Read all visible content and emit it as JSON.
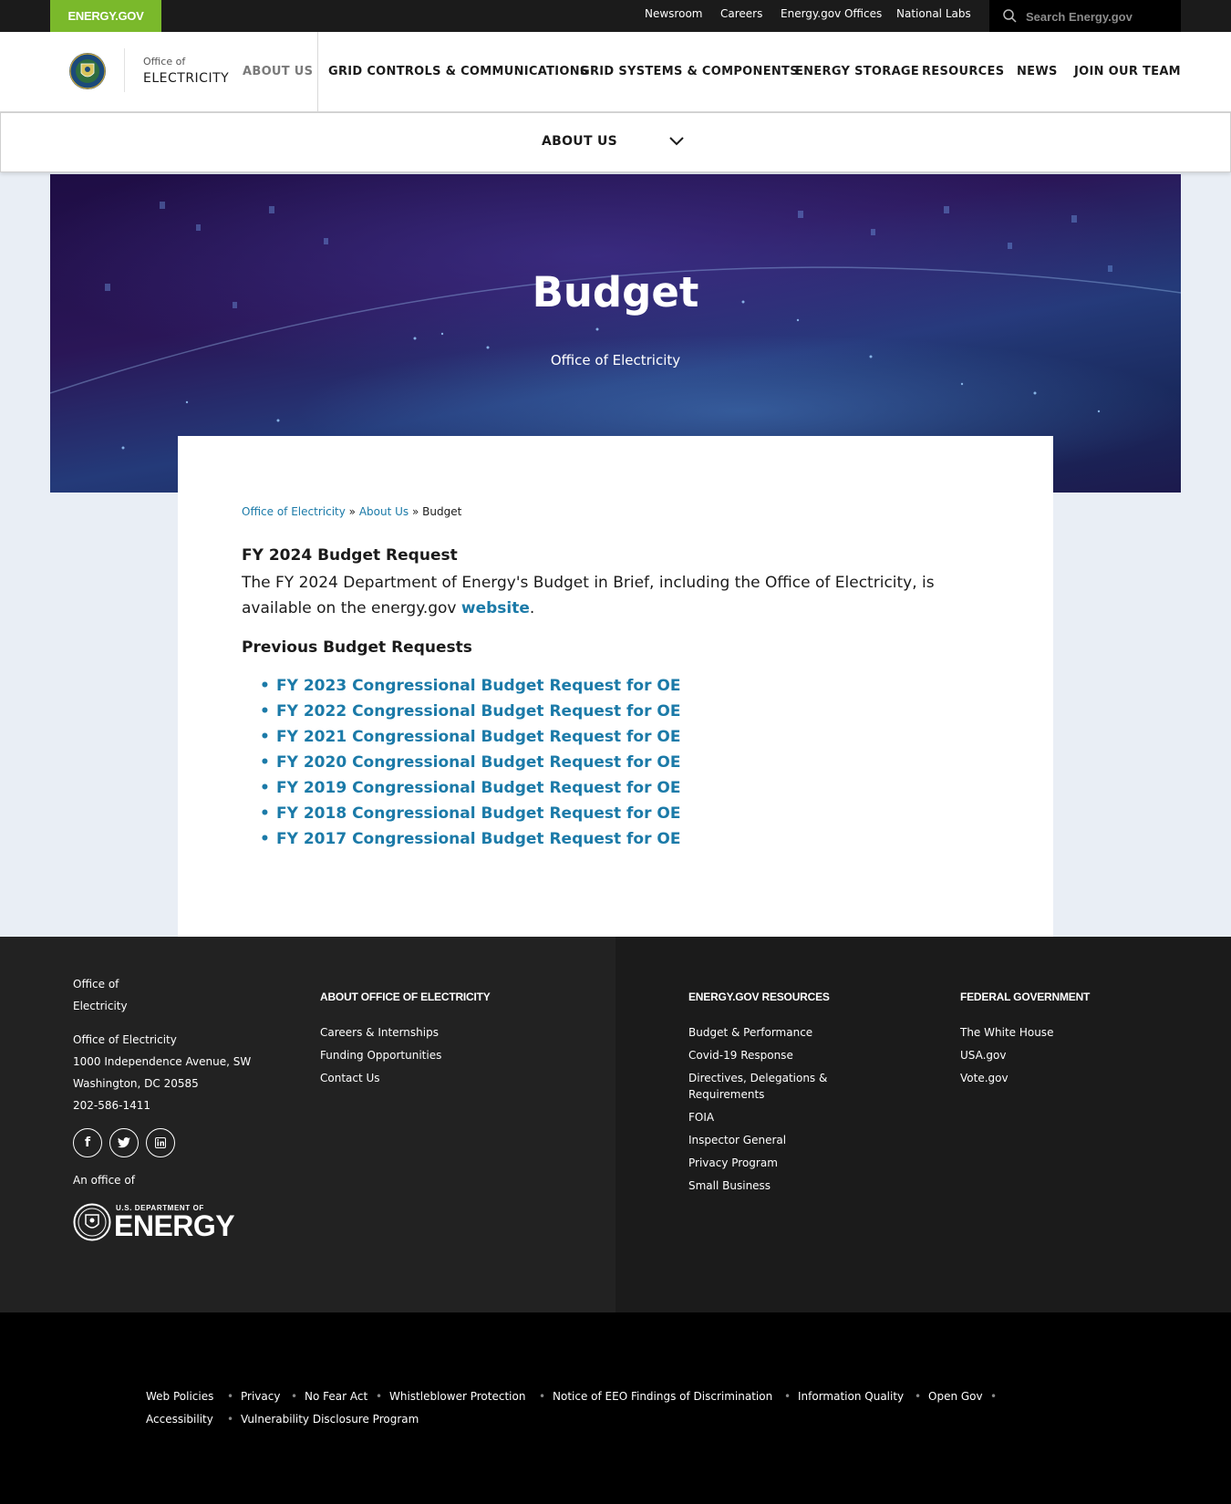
{
  "utility": {
    "brand": "ENERGY.GOV",
    "links": [
      "Newsroom",
      "Careers",
      "Energy.gov Offices",
      "National Labs"
    ],
    "search_placeholder": "Search Energy.gov"
  },
  "header": {
    "logo_small": "Office of",
    "logo_big": "ELECTRICITY",
    "nav": [
      "ABOUT US",
      "GRID CONTROLS & COMMUNICATIONS",
      "GRID SYSTEMS & COMPONENTS",
      "ENERGY STORAGE",
      "RESOURCES",
      "NEWS",
      "JOIN OUR TEAM"
    ]
  },
  "subnav": {
    "label": "ABOUT US"
  },
  "hero": {
    "title": "Budget",
    "subtitle": "Office of Electricity"
  },
  "breadcrumb": {
    "home": "Office of Electricity",
    "parent": "About Us",
    "current": "Budget",
    "sep": "»"
  },
  "content": {
    "heading": "FY 2024 Budget Request",
    "para_text": "The FY 2024 Department of Energy's Budget in Brief, including the Office of Electricity, is available on the energy.gov",
    "para_link": "website",
    "para_end": ".",
    "prev_heading": "Previous Budget Requests",
    "budget_links": [
      "FY 2023 Congressional Budget Request for OE",
      "FY 2022 Congressional Budget Request for OE",
      "FY 2021 Congressional Budget Request for OE",
      "FY 2020 Congressional Budget Request for OE",
      "FY 2019 Congressional Budget Request for OE",
      "FY 2018 Congressional Budget Request for OE",
      "FY 2017 Congressional Budget Request for OE"
    ]
  },
  "footer": {
    "office_line1": "Office of",
    "office_line2": "Electricity",
    "address": [
      "Office of Electricity",
      "1000 Independence Avenue, SW",
      "Washington, DC 20585",
      "202-586-1411"
    ],
    "an_office_of": "An office of",
    "doe_small": "U.S. DEPARTMENT OF",
    "doe_big": "ENERGY",
    "col_about": {
      "title": "ABOUT OFFICE OF ELECTRICITY",
      "links": [
        "Careers & Internships",
        "Funding Opportunities",
        "Contact Us"
      ]
    },
    "col_resources": {
      "title": "ENERGY.GOV RESOURCES",
      "links": [
        "Budget & Performance",
        "Covid-19 Response",
        "Directives, Delegations &",
        "Requirements",
        "FOIA",
        "Inspector General",
        "Privacy Program",
        "Small Business"
      ]
    },
    "col_federal": {
      "title": "FEDERAL GOVERNMENT",
      "links": [
        "The White House",
        "USA.gov",
        "Vote.gov"
      ]
    }
  },
  "bottom": {
    "links": [
      "Web Policies",
      "Privacy",
      "No Fear Act",
      "Whistleblower Protection",
      "Notice of EEO Findings of Discrimination",
      "Information Quality",
      "Open Gov",
      "Accessibility",
      "Vulnerability Disclosure Program"
    ]
  }
}
